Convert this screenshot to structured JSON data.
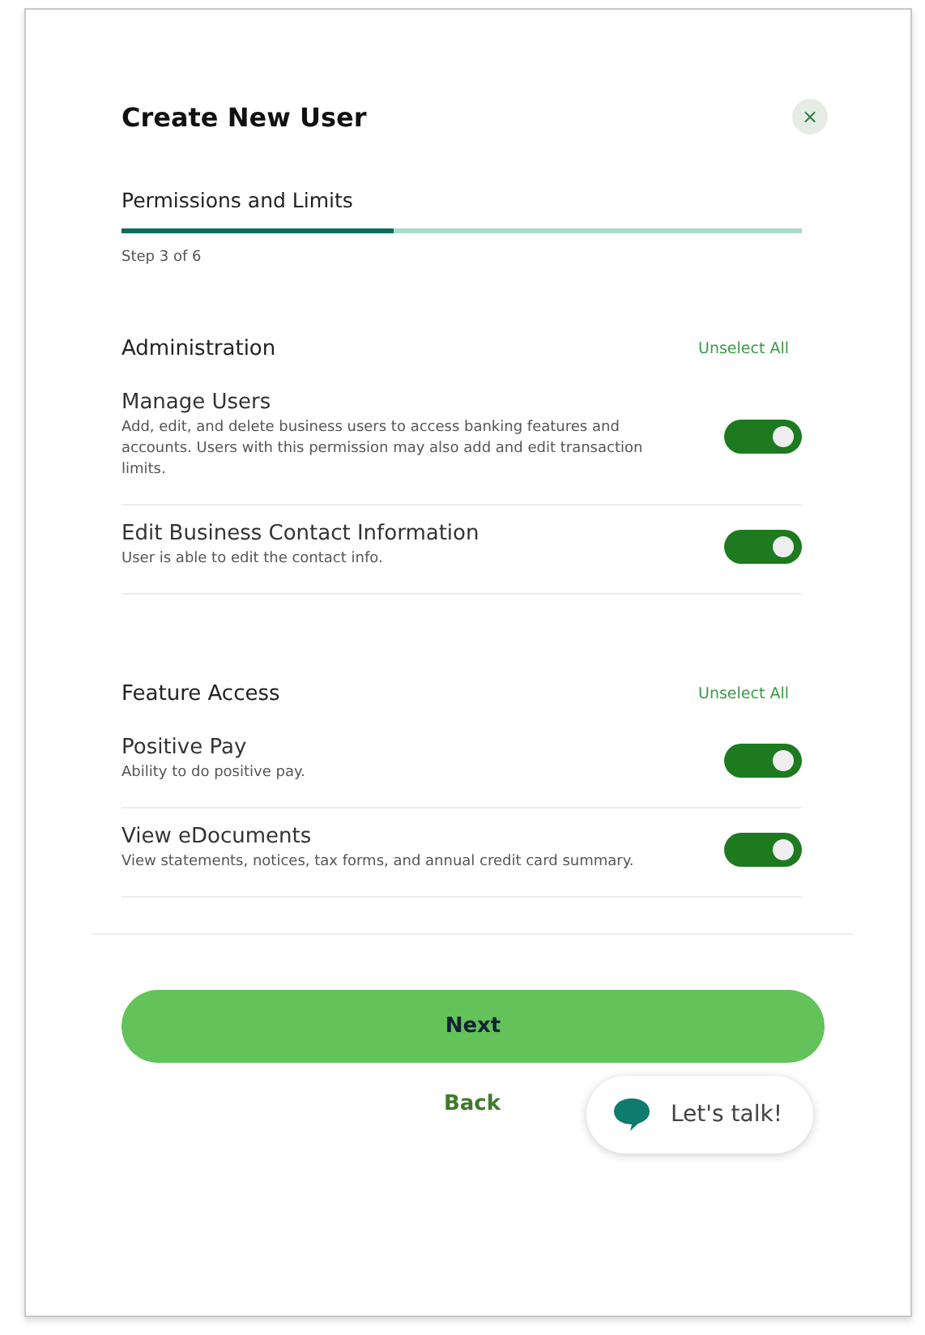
{
  "dialog": {
    "title": "Create New User",
    "close_label": "×"
  },
  "progress": {
    "step_name": "Permissions and Limits",
    "level": 0.4,
    "step_text": "Step 3 of 6"
  },
  "sections": [
    {
      "title": "Administration",
      "action": "Unselect All",
      "permissions": [
        {
          "name": "Manage Users",
          "description": "Add, edit, and delete business users to access banking features and accounts. Users with this permission may also add and edit transaction limits.",
          "on": true
        },
        {
          "name": "Edit Business Contact Information",
          "description": "User is able to edit the contact info.",
          "on": true
        }
      ]
    },
    {
      "title": "Feature Access",
      "action": "Unselect All",
      "permissions": [
        {
          "name": "Positive Pay",
          "description": "Ability to do positive pay.",
          "on": true
        },
        {
          "name": "View eDocuments",
          "description": "View statements, notices, tax forms, and annual credit card summary.",
          "on": true
        }
      ]
    }
  ],
  "buttons": {
    "next": "Next",
    "back": "Back"
  },
  "chat": {
    "label": "Let's talk!"
  }
}
